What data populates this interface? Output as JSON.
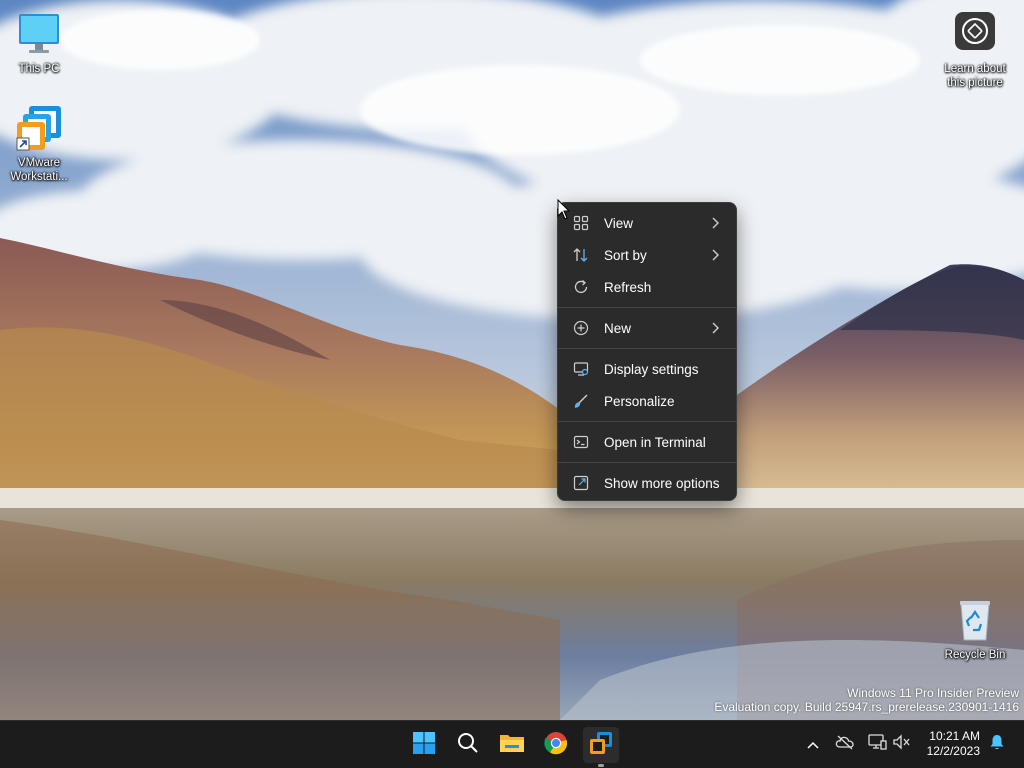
{
  "desktop": {
    "icons": [
      {
        "label": "This PC",
        "icon": "monitor-icon"
      },
      {
        "label": "VMware Workstati...",
        "icon": "vmware-icon"
      },
      {
        "label": "Learn about this picture",
        "icon": "camera-icon"
      },
      {
        "label": "Recycle Bin",
        "icon": "recycle-bin-icon"
      }
    ]
  },
  "context_menu": {
    "items": [
      {
        "label": "View",
        "icon": "grid-icon",
        "submenu": true
      },
      {
        "label": "Sort by",
        "icon": "sort-icon",
        "submenu": true
      },
      {
        "label": "Refresh",
        "icon": "refresh-icon",
        "submenu": false
      },
      {
        "label": "New",
        "icon": "plus-circle-icon",
        "submenu": true
      },
      {
        "label": "Display settings",
        "icon": "display-icon",
        "submenu": false
      },
      {
        "label": "Personalize",
        "icon": "brush-icon",
        "submenu": false
      },
      {
        "label": "Open in Terminal",
        "icon": "terminal-icon",
        "submenu": false
      },
      {
        "label": "Show more options",
        "icon": "more-options-icon",
        "submenu": false
      }
    ]
  },
  "watermark": {
    "line1": "Windows 11 Pro Insider Preview",
    "line2": "Evaluation copy. Build 25947.rs_prerelease.230901-1416"
  },
  "taskbar": {
    "apps": [
      "start-icon",
      "search-icon",
      "file-explorer-icon",
      "chrome-icon",
      "vmware-icon"
    ],
    "tray": [
      "chevron-up-icon",
      "cloud-offline-icon",
      "network-icon",
      "speaker-muted-icon",
      "bell-icon"
    ],
    "time": "10:21 AM",
    "date": "12/2/2023"
  },
  "colors": {
    "taskbar_bg": "#1c1c1c",
    "menu_bg": "#2b2b2b",
    "accent": "#0078d4"
  }
}
